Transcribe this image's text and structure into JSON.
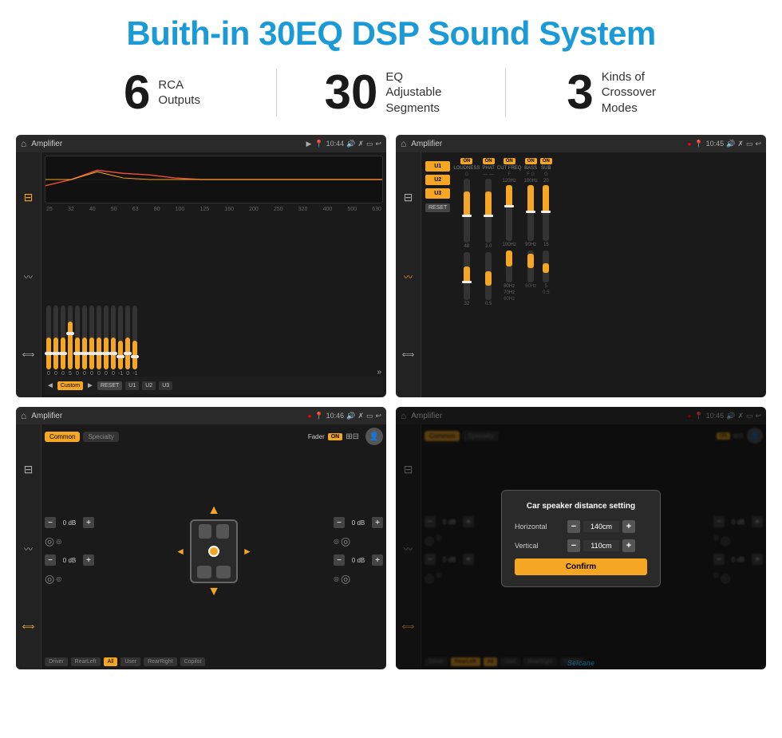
{
  "header": {
    "title": "Buith-in 30EQ DSP Sound System"
  },
  "stats": [
    {
      "number": "6",
      "text": "RCA\nOutputs"
    },
    {
      "number": "30",
      "text": "EQ Adjustable\nSegments"
    },
    {
      "number": "3",
      "text": "Kinds of\nCrossover Modes"
    }
  ],
  "screens": {
    "eq": {
      "title": "Amplifier",
      "time": "10:44",
      "freq_labels": [
        "25",
        "32",
        "40",
        "50",
        "63",
        "80",
        "100",
        "125",
        "160",
        "200",
        "250",
        "320",
        "400",
        "500",
        "630"
      ],
      "slider_values": [
        "0",
        "0",
        "0",
        "5",
        "0",
        "0",
        "0",
        "0",
        "0",
        "0",
        "-1",
        "0",
        "-1"
      ],
      "bottom_buttons": [
        "Custom",
        "RESET",
        "U1",
        "U2",
        "U3"
      ]
    },
    "amp": {
      "title": "Amplifier",
      "time": "10:45",
      "presets": [
        "U1",
        "U2",
        "U3"
      ],
      "channels": [
        "LOUDNESS",
        "PHAT",
        "CUT FREQ",
        "BASS",
        "SUB"
      ],
      "reset_label": "RESET"
    },
    "fader": {
      "title": "Amplifier",
      "time": "10:46",
      "tabs": [
        "Common",
        "Specialty"
      ],
      "fader_label": "Fader",
      "on_label": "ON",
      "zones": [
        "Driver",
        "RearLeft",
        "All",
        "User",
        "RearRight",
        "Copilot"
      ],
      "db_values": [
        "0 dB",
        "0 dB",
        "0 dB",
        "0 dB"
      ]
    },
    "distance": {
      "title": "Amplifier",
      "time": "10:46",
      "dialog": {
        "title": "Car speaker distance setting",
        "horizontal_label": "Horizontal",
        "horizontal_value": "140cm",
        "vertical_label": "Vertical",
        "vertical_value": "110cm",
        "confirm_label": "Confirm"
      }
    }
  },
  "watermark": "Seicane"
}
